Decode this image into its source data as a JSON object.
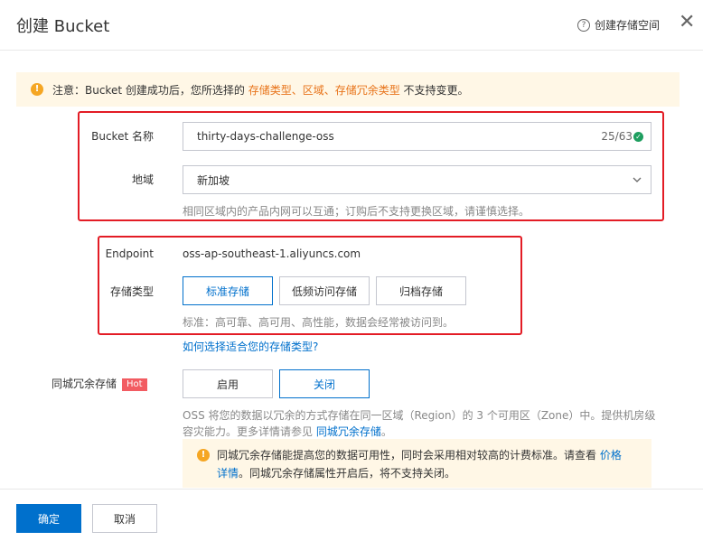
{
  "dialog": {
    "title": "创建 Bucket",
    "help_link": "创建存储空间",
    "help_icon": "question-circle-icon",
    "close_icon": "close-icon"
  },
  "notice": {
    "prefix": "注意：Bucket 创建成功后，您所选择的 ",
    "highlight": "存储类型、区域、存储冗余类型",
    "suffix": " 不支持变更。",
    "highlight_color": "#e8741a"
  },
  "form": {
    "bucket_name": {
      "label": "Bucket 名称",
      "value": "thirty-days-challenge-oss",
      "counter": "25/63",
      "valid_icon": "check-circle-icon"
    },
    "region": {
      "label": "地域",
      "value": "新加坡",
      "hint": "相同区域内的产品内网可以互通；订购后不支持更换区域，请谨慎选择。"
    },
    "endpoint": {
      "label": "Endpoint",
      "value": "oss-ap-southeast-1.aliyuncs.com"
    },
    "storage_class": {
      "label": "存储类型",
      "options": [
        "标准存储",
        "低频访问存储",
        "归档存储"
      ],
      "selected": "标准存储",
      "hint": "标准：高可靠、高可用、高性能，数据会经常被访问到。",
      "help_link": "如何选择适合您的存储类型?"
    },
    "redundancy": {
      "label": "同城冗余存储",
      "badge": "Hot",
      "options": [
        "启用",
        "关闭"
      ],
      "selected": "关闭",
      "desc_line1": "OSS 将您的数据以冗余的方式存储在同一区域（Region）的 3 个可用区（Zone）中。提供机房级",
      "desc_line2_prefix": "容灾能力。更多详情请参见 ",
      "desc_link": "同城冗余存储",
      "desc_line2_suffix": "。",
      "warn_line1_prefix": "同城冗余存储能提高您的数据可用性，同时会采用相对较高的计费标准。请查看 ",
      "warn_link_part1": "价格",
      "warn_link_part2": "详情",
      "warn_line2_suffix": "。同城冗余存储属性开启后，将不支持关闭。"
    }
  },
  "footer": {
    "confirm": "确定",
    "cancel": "取消"
  },
  "colors": {
    "primary": "#0070cc",
    "annotation_red": "#e31c25",
    "warning_bg": "#fff7e6",
    "hot_badge": "#f25c62"
  }
}
